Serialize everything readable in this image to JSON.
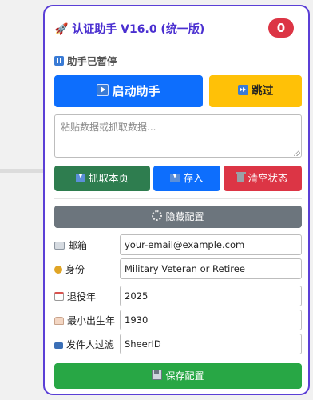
{
  "header": {
    "icon": "rocket-icon",
    "title": "🚀 认证助手 V16.0 (统一版)",
    "badge_count": "0"
  },
  "status": {
    "text": "助手已暂停"
  },
  "actions": {
    "start_label": "启动助手",
    "skip_label": "跳过"
  },
  "paste": {
    "placeholder": "粘贴数据或抓取数据...",
    "value": ""
  },
  "tools": {
    "scrape_label": "抓取本页",
    "save_label": "存入",
    "clear_label": "清空状态"
  },
  "config_toggle": {
    "label": "隐藏配置"
  },
  "config": {
    "fields": [
      {
        "label": "邮箱",
        "value": "your-email@example.com",
        "icon": "id-card-icon"
      },
      {
        "label": "身份",
        "value": "Military Veteran or Retiree",
        "icon": "medal-icon"
      },
      {
        "label": "退役年",
        "value": "2025",
        "icon": "calendar-icon"
      },
      {
        "label": "最小出生年",
        "value": "1930",
        "icon": "cake-icon"
      },
      {
        "label": "发件人过滤",
        "value": "SheerID",
        "icon": "mailbox-icon"
      }
    ],
    "save_label": "保存配置"
  },
  "colors": {
    "accent": "#5b3fd6",
    "primary": "#0d6efd",
    "warning": "#ffc107",
    "success_dark": "#2e7d4f",
    "danger": "#dc3545",
    "secondary": "#6c757d",
    "success": "#28a745"
  }
}
